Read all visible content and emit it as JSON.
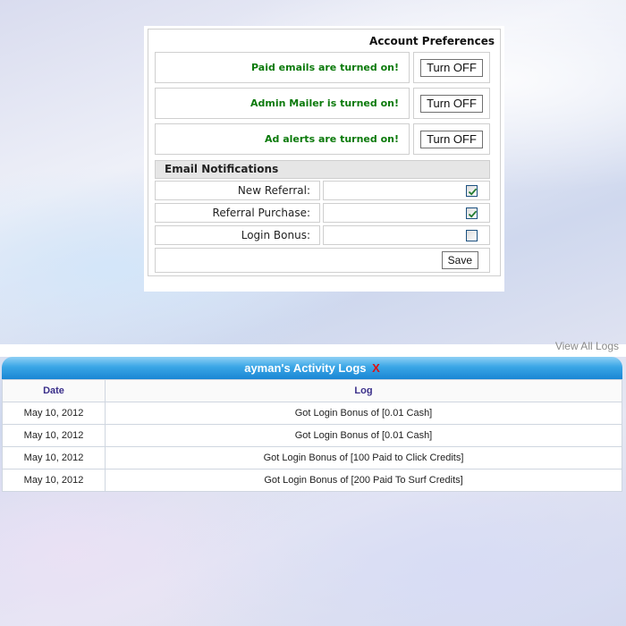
{
  "preferences": {
    "title": "Account Preferences",
    "toggles": [
      {
        "status": "Paid emails are turned on!",
        "button": "Turn OFF"
      },
      {
        "status": "Admin Mailer is turned on!",
        "button": "Turn OFF"
      },
      {
        "status": "Ad alerts are turned on!",
        "button": "Turn OFF"
      }
    ],
    "notifications": {
      "header": "Email Notifications",
      "items": [
        {
          "label": "New Referral:",
          "checked": true
        },
        {
          "label": "Referral Purchase:",
          "checked": true
        },
        {
          "label": "Login Bonus:",
          "checked": false
        }
      ]
    },
    "save_label": "Save"
  },
  "activity": {
    "view_all": "View All Logs",
    "title": "ayman's Activity Logs",
    "close": "X",
    "columns": [
      "Date",
      "Log"
    ],
    "rows": [
      {
        "date": "May 10, 2012",
        "log": "Got Login Bonus of [0.01 Cash]"
      },
      {
        "date": "May 10, 2012",
        "log": "Got Login Bonus of [0.01 Cash]"
      },
      {
        "date": "May 10, 2012",
        "log": "Got Login Bonus of [100 Paid to Click Credits]"
      },
      {
        "date": "May 10, 2012",
        "log": "Got Login Bonus of [200 Paid To Surf Credits]"
      }
    ]
  },
  "colors": {
    "status_text": "#0b7a0b",
    "header_blue": "#1a86d4",
    "close_red": "#e01010",
    "column_header": "#3a2f8a"
  }
}
